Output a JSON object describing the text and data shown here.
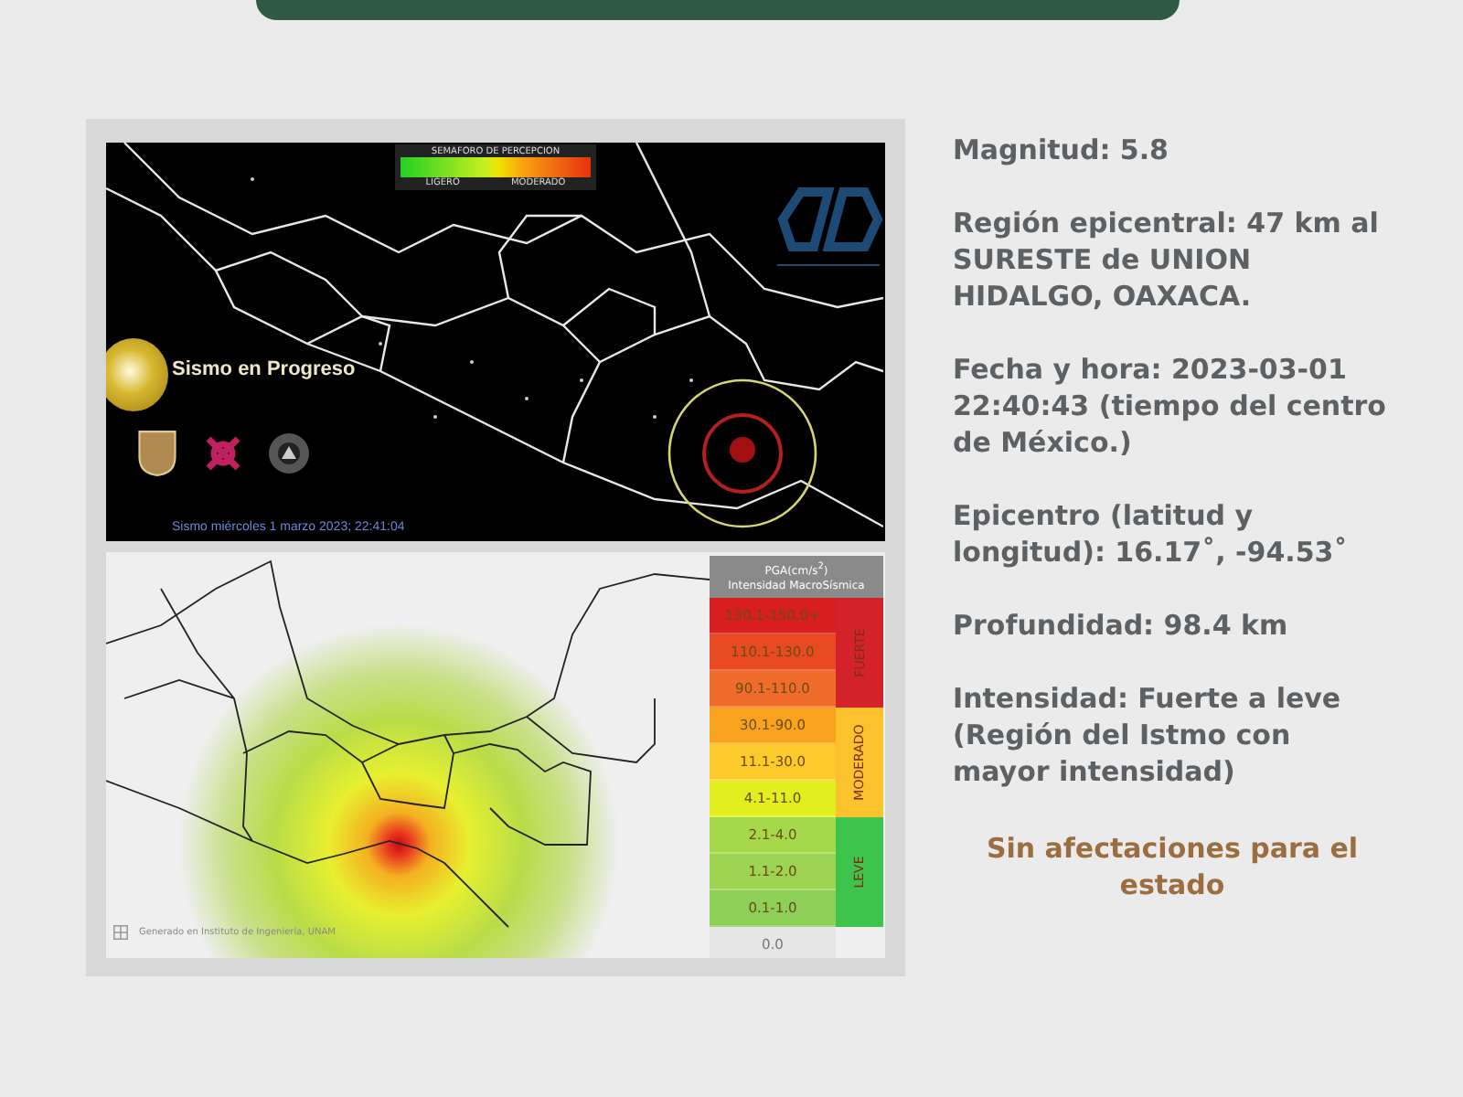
{
  "seismic_map": {
    "perception_scale": {
      "title": "SEMAFORO DE PERCEPCION",
      "labels": [
        "LIGERO",
        "MODERADO"
      ]
    },
    "status": "Sismo en Progreso",
    "timestamp": "Sismo miércoles 1 marzo 2023; 22:41:04"
  },
  "intensity_map": {
    "credit": "Generado en Instituto de Ingeniería, UNAM",
    "legend": {
      "header": "PGA(cm/s$^{2}$)",
      "subheader": "Intensidad MacroSísmica",
      "groups": [
        {
          "label": "FUERTE",
          "color": "#d3222a",
          "rows": [
            {
              "range": "130.1-150.0+",
              "color": "#d81e1e"
            },
            {
              "range": "110.1-130.0",
              "color": "#e84a22"
            },
            {
              "range": "90.1-110.0",
              "color": "#f06c2a"
            }
          ]
        },
        {
          "label": "MODERADO",
          "color": "#fbc22e",
          "rows": [
            {
              "range": "30.1-90.0",
              "color": "#f8a21e"
            },
            {
              "range": "11.1-30.0",
              "color": "#fcca2a"
            },
            {
              "range": "4.1-11.0",
              "color": "#e2ee1e"
            }
          ]
        },
        {
          "label": "LEVE",
          "color": "#3ec44c",
          "rows": [
            {
              "range": "2.1-4.0",
              "color": "#a6d84c"
            },
            {
              "range": "1.1-2.0",
              "color": "#9cd452"
            },
            {
              "range": "0.1-1.0",
              "color": "#8ecf58"
            }
          ]
        }
      ],
      "zero": "0.0"
    }
  },
  "details": [
    "Magnitud: 5.8",
    "Región epicentral: 47 km al SURESTE de UNION HIDALGO, OAXACA.",
    "Fecha y hora: 2023-03-01 22:40:43 (tiempo del centro de México.)",
    "Epicentro (latitud y longitud): 16.17˚, -94.53˚",
    "Profundidad: 98.4 km",
    "Intensidad: Fuerte a leve (Región del Istmo con mayor intensidad)"
  ],
  "note": "Sin afectaciones para el estado"
}
